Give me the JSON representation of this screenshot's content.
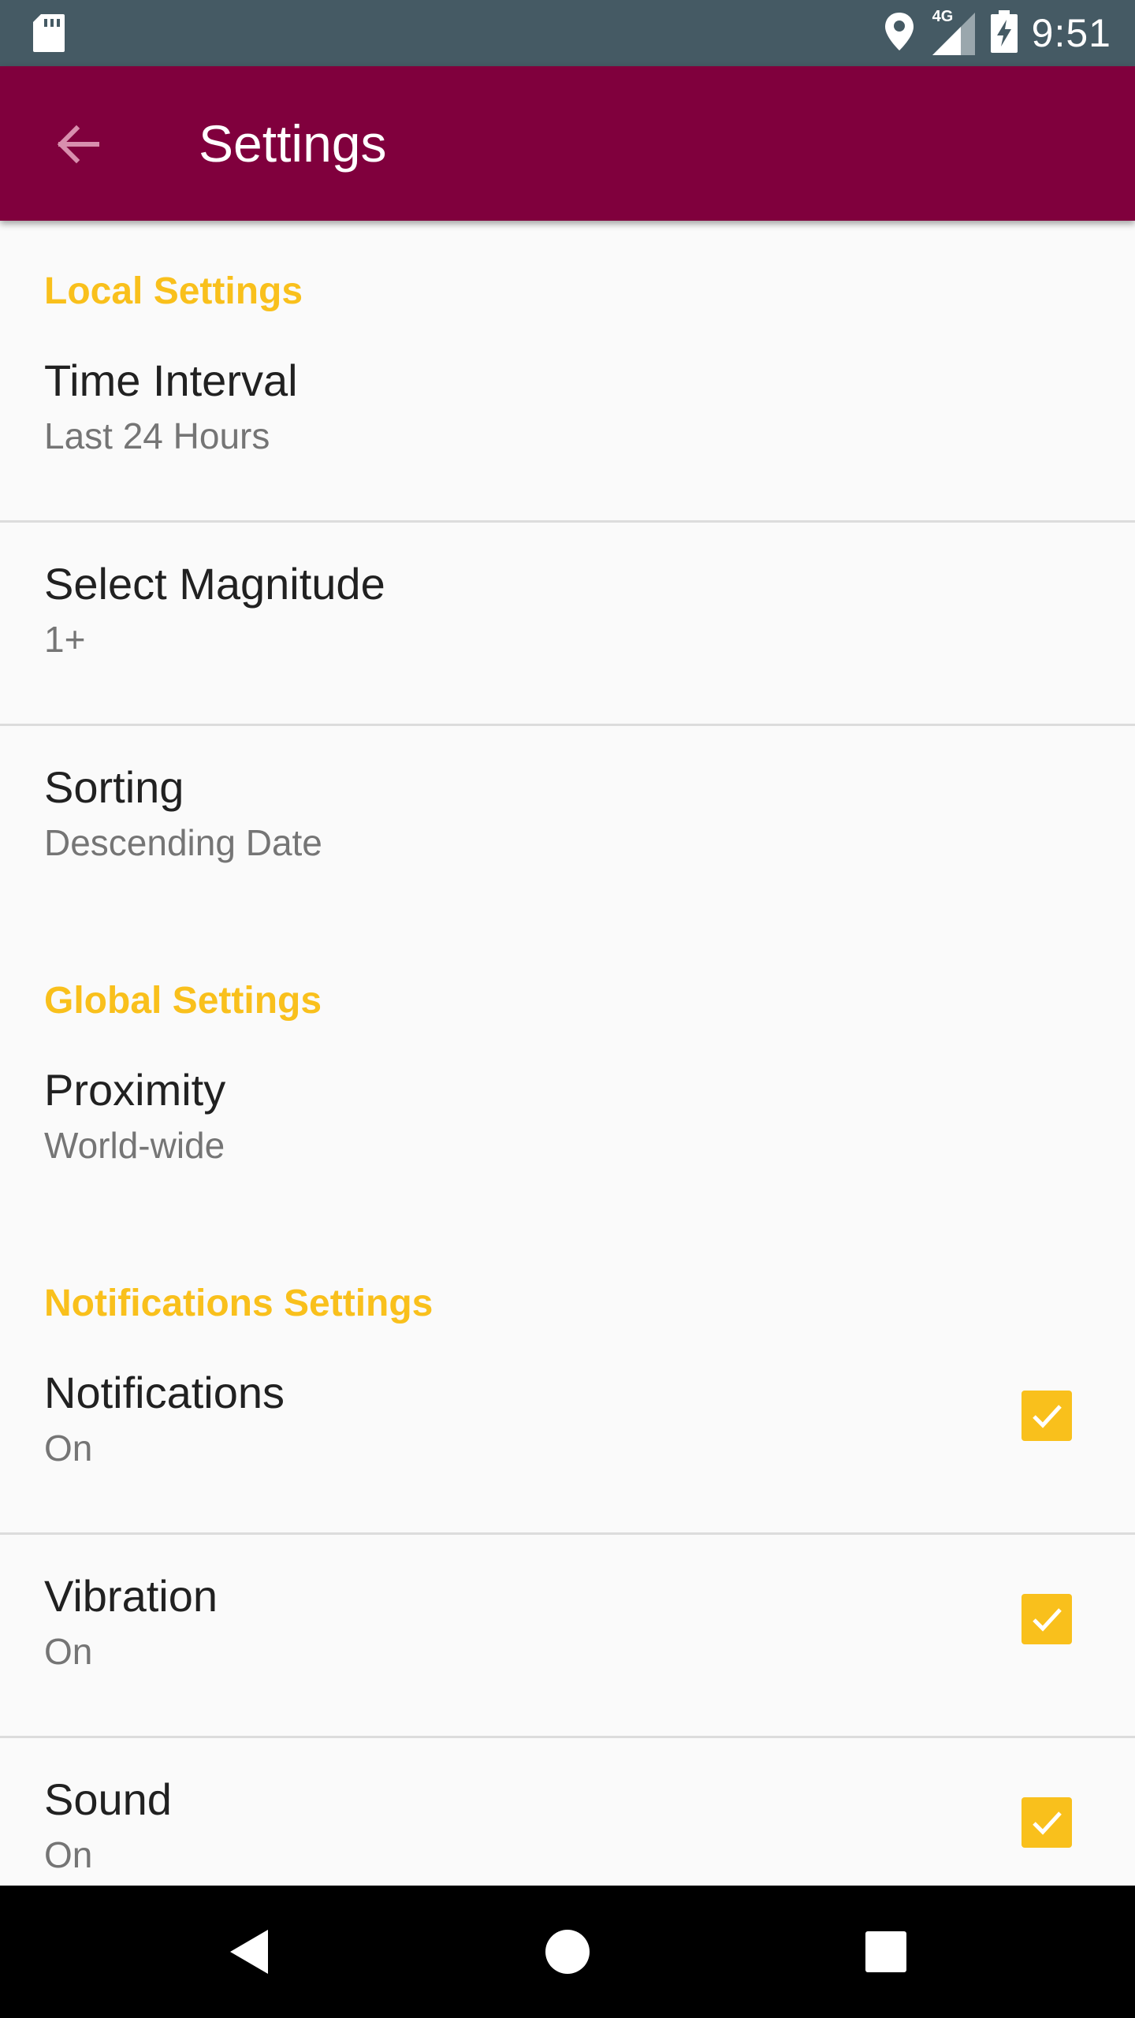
{
  "status_bar": {
    "network_label": "4G",
    "time": "9:51",
    "icons": [
      "sd-card-icon",
      "location-icon",
      "signal-icon",
      "battery-charging-icon"
    ]
  },
  "app_bar": {
    "title": "Settings",
    "back_icon": "arrow-back-icon",
    "color": "#80003d"
  },
  "sections": {
    "local": {
      "header": "Local Settings",
      "time_interval": {
        "title": "Time Interval",
        "value": "Last 24 Hours"
      },
      "magnitude": {
        "title": "Select Magnitude",
        "value": "1+"
      },
      "sorting": {
        "title": "Sorting",
        "value": "Descending Date"
      }
    },
    "global": {
      "header": "Global Settings",
      "proximity": {
        "title": "Proximity",
        "value": "World-wide"
      }
    },
    "notifications": {
      "header": "Notifications Settings",
      "notifications": {
        "title": "Notifications",
        "value": "On",
        "checked": true
      },
      "vibration": {
        "title": "Vibration",
        "value": "On",
        "checked": true
      },
      "sound": {
        "title": "Sound",
        "value": "On",
        "checked": true
      }
    }
  },
  "colors": {
    "accent": "#f9c01c",
    "status_bar": "#455a64",
    "background": "#fafafa"
  },
  "nav_bar": {
    "icons": [
      "back-triangle-icon",
      "home-circle-icon",
      "recents-square-icon"
    ]
  }
}
